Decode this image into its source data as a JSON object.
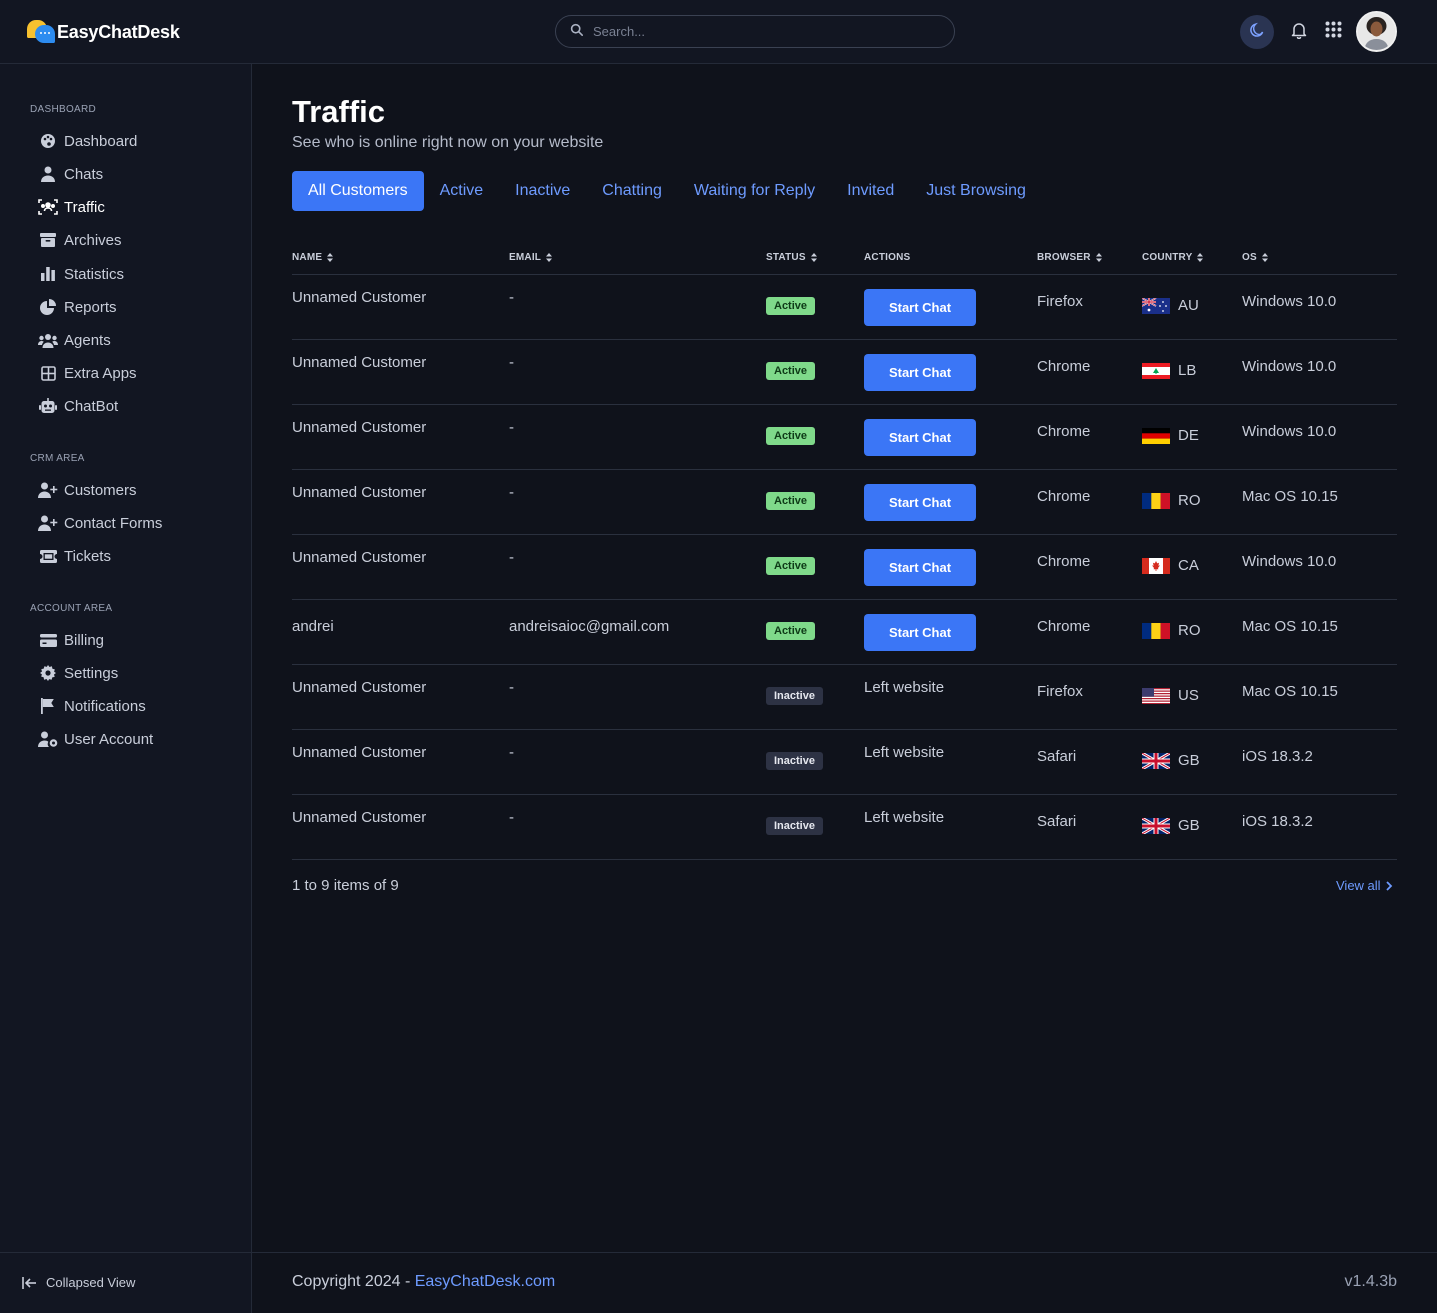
{
  "app": {
    "name": "EasyChatDesk"
  },
  "search": {
    "placeholder": "Search..."
  },
  "sidebar": {
    "sections": [
      {
        "title": "DASHBOARD",
        "items": [
          {
            "label": "Dashboard",
            "icon": "palette-icon"
          },
          {
            "label": "Chats",
            "icon": "user-icon"
          },
          {
            "label": "Traffic",
            "icon": "traffic-icon",
            "active": true
          },
          {
            "label": "Archives",
            "icon": "archive-icon"
          },
          {
            "label": "Statistics",
            "icon": "bar-chart-icon"
          },
          {
            "label": "Reports",
            "icon": "pie-chart-icon"
          },
          {
            "label": "Agents",
            "icon": "users-icon"
          },
          {
            "label": "Extra Apps",
            "icon": "grid-icon"
          },
          {
            "label": "ChatBot",
            "icon": "robot-icon"
          }
        ]
      },
      {
        "title": "CRM AREA",
        "items": [
          {
            "label": "Customers",
            "icon": "user-plus-icon"
          },
          {
            "label": "Contact Forms",
            "icon": "user-plus-icon"
          },
          {
            "label": "Tickets",
            "icon": "ticket-icon"
          }
        ]
      },
      {
        "title": "ACCOUNT AREA",
        "items": [
          {
            "label": "Billing",
            "icon": "credit-card-icon"
          },
          {
            "label": "Settings",
            "icon": "gear-icon"
          },
          {
            "label": "Notifications",
            "icon": "flag-icon"
          },
          {
            "label": "User Account",
            "icon": "user-gear-icon"
          }
        ]
      }
    ],
    "collapse_label": "Collapsed View"
  },
  "page": {
    "title": "Traffic",
    "subtitle": "See who is online right now on your website"
  },
  "tabs": [
    {
      "label": "All Customers",
      "active": true
    },
    {
      "label": "Active"
    },
    {
      "label": "Inactive"
    },
    {
      "label": "Chatting"
    },
    {
      "label": "Waiting for Reply"
    },
    {
      "label": "Invited"
    },
    {
      "label": "Just Browsing"
    }
  ],
  "table": {
    "headers": {
      "name": "NAME",
      "email": "EMAIL",
      "status": "STATUS",
      "actions": "ACTIONS",
      "browser": "BROWSER",
      "country": "COUNTRY",
      "os": "OS"
    },
    "rows": [
      {
        "name": "Unnamed Customer",
        "email": "-",
        "status": "Active",
        "action": "Start Chat",
        "browser": "Firefox",
        "country": "AU",
        "os": "Windows 10.0"
      },
      {
        "name": "Unnamed Customer",
        "email": "-",
        "status": "Active",
        "action": "Start Chat",
        "browser": "Chrome",
        "country": "LB",
        "os": "Windows 10.0"
      },
      {
        "name": "Unnamed Customer",
        "email": "-",
        "status": "Active",
        "action": "Start Chat",
        "browser": "Chrome",
        "country": "DE",
        "os": "Windows 10.0"
      },
      {
        "name": "Unnamed Customer",
        "email": "-",
        "status": "Active",
        "action": "Start Chat",
        "browser": "Chrome",
        "country": "RO",
        "os": "Mac OS 10.15"
      },
      {
        "name": "Unnamed Customer",
        "email": "-",
        "status": "Active",
        "action": "Start Chat",
        "browser": "Chrome",
        "country": "CA",
        "os": "Windows 10.0"
      },
      {
        "name": "andrei",
        "email": "andreisaioc@gmail.com",
        "status": "Active",
        "action": "Start Chat",
        "browser": "Chrome",
        "country": "RO",
        "os": "Mac OS 10.15"
      },
      {
        "name": "Unnamed Customer",
        "email": "-",
        "status": "Inactive",
        "action": "Left website",
        "browser": "Firefox",
        "country": "US",
        "os": "Mac OS 10.15"
      },
      {
        "name": "Unnamed Customer",
        "email": "-",
        "status": "Inactive",
        "action": "Left website",
        "browser": "Safari",
        "country": "GB",
        "os": "iOS 18.3.2"
      },
      {
        "name": "Unnamed Customer",
        "email": "-",
        "status": "Inactive",
        "action": "Left website",
        "browser": "Safari",
        "country": "GB",
        "os": "iOS 18.3.2"
      }
    ]
  },
  "pagination": {
    "summary": "1 to 9 items of 9",
    "view_all": "View all"
  },
  "footer": {
    "copyright_prefix": "Copyright 2024 - ",
    "copyright_link": "EasyChatDesk.com",
    "version": "v1.4.3b"
  },
  "colors": {
    "accent": "#3b76f6",
    "active_badge": "#7fd98a",
    "link": "#6e9bff",
    "background": "#0f121b"
  }
}
